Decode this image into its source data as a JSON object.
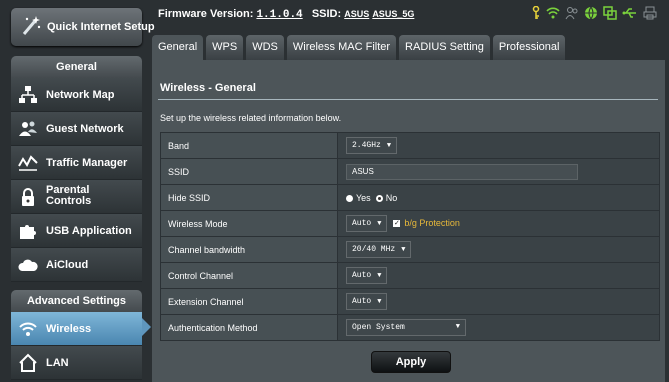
{
  "top": {
    "firmware_label": "Firmware Version:",
    "firmware_value": "1.1.0.4",
    "ssid_label": "SSID:",
    "ssid_24": "ASUS",
    "ssid_5": "ASUS_5G"
  },
  "sidebar": {
    "quick_setup": "Quick Internet Setup",
    "general_head": "General",
    "general_items": [
      {
        "label": "Network Map",
        "icon": "network-map-icon"
      },
      {
        "label": "Guest Network",
        "icon": "guest-network-icon"
      },
      {
        "label": "Traffic Manager",
        "icon": "traffic-manager-icon"
      },
      {
        "label": "Parental Controls",
        "icon": "parental-controls-icon"
      },
      {
        "label": "USB Application",
        "icon": "usb-application-icon"
      },
      {
        "label": "AiCloud",
        "icon": "aicloud-icon"
      }
    ],
    "advanced_head": "Advanced Settings",
    "advanced_items": [
      {
        "label": "Wireless",
        "icon": "wireless-icon"
      },
      {
        "label": "LAN",
        "icon": "lan-icon"
      }
    ]
  },
  "tabs": [
    "General",
    "WPS",
    "WDS",
    "Wireless MAC Filter",
    "RADIUS Setting",
    "Professional"
  ],
  "panel": {
    "title": "Wireless - General",
    "description": "Set up the wireless related information below.",
    "rows": {
      "band_label": "Band",
      "band_value": "2.4GHz",
      "ssid_label": "SSID",
      "ssid_value": "ASUS",
      "hide_label": "Hide SSID",
      "hide_yes": "Yes",
      "hide_no": "No",
      "mode_label": "Wireless Mode",
      "mode_value": "Auto",
      "bg_protection": "b/g Protection",
      "bw_label": "Channel bandwidth",
      "bw_value": "20/40 MHz",
      "cc_label": "Control Channel",
      "cc_value": "Auto",
      "ec_label": "Extension Channel",
      "ec_value": "Auto",
      "auth_label": "Authentication Method",
      "auth_value": "Open System"
    },
    "apply": "Apply"
  },
  "colors": {
    "accent": "#4a86b0",
    "warning": "#e8b93a",
    "status_green": "#7bd23c"
  }
}
